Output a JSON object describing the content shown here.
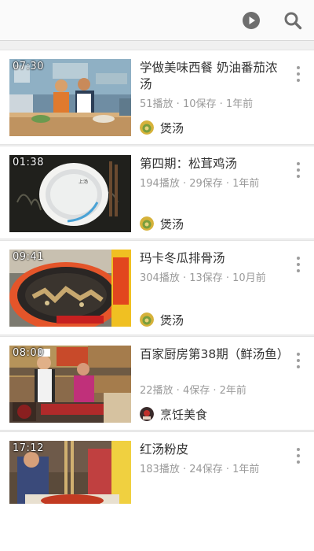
{
  "toolbar": {
    "play_icon": "play-circle-icon",
    "search_icon": "search-icon"
  },
  "videos": [
    {
      "duration": "07:30",
      "title": "学做美味西餐 奶油番茄浓汤",
      "meta": "51播放 · 10保存 · 1年前",
      "channel": "煲汤"
    },
    {
      "duration": "01:38",
      "title": "第四期：松茸鸡汤",
      "meta": "194播放 · 29保存 · 1年前",
      "channel": "煲汤"
    },
    {
      "duration": "09:41",
      "title": "玛卡冬瓜排骨汤",
      "meta": "304播放 · 13保存 · 10月前",
      "channel": "煲汤"
    },
    {
      "duration": "08:00",
      "title": "百家厨房第38期（鲜汤鱼）",
      "meta": "22播放 · 4保存 · 2年前",
      "channel": "烹饪美食"
    },
    {
      "duration": "17:12",
      "title": "红汤粉皮",
      "meta": "183播放 · 24保存 · 1年前",
      "channel": ""
    }
  ],
  "colors": {
    "meta": "#9a9a9a",
    "title": "#333333",
    "background": "#f0f0f0"
  }
}
